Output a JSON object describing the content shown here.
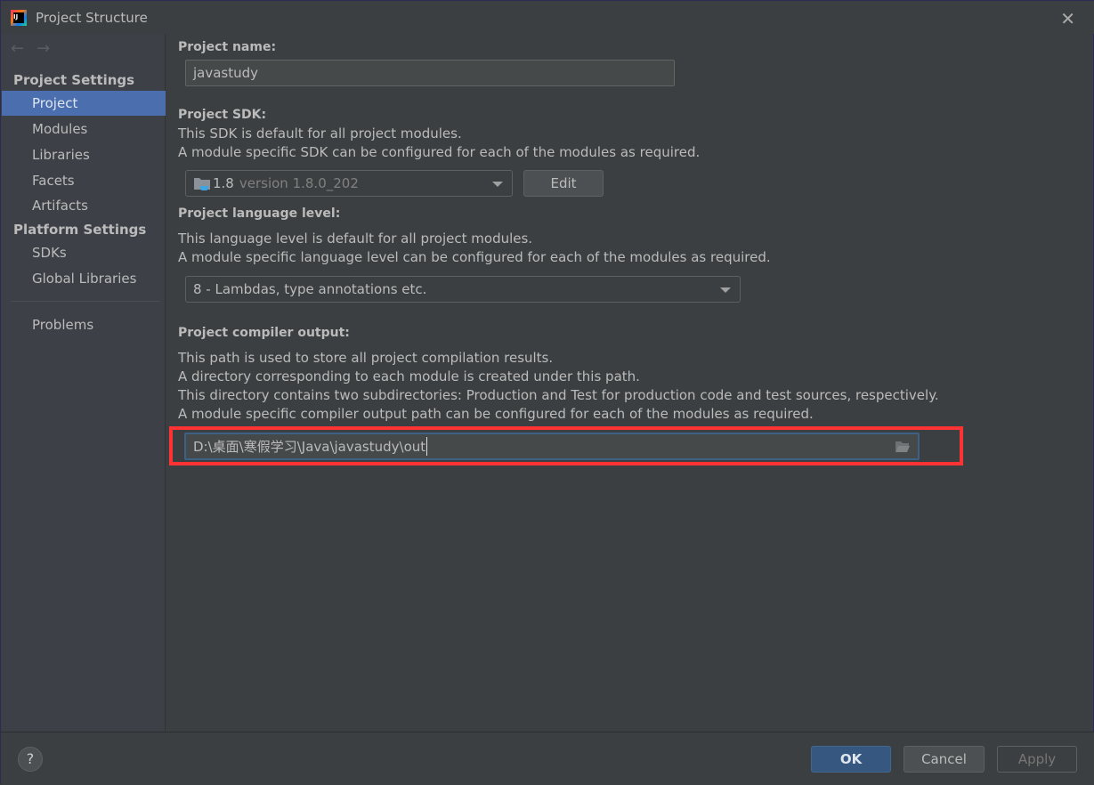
{
  "window": {
    "title": "Project Structure",
    "close": "✕"
  },
  "nav": {
    "back": "←",
    "forward": "→"
  },
  "sidebar": {
    "project_settings": "Project Settings",
    "project_items": [
      {
        "label": "Project",
        "selected": true
      },
      {
        "label": "Modules"
      },
      {
        "label": "Libraries"
      },
      {
        "label": "Facets"
      },
      {
        "label": "Artifacts"
      }
    ],
    "platform_settings": "Platform Settings",
    "platform_items": [
      {
        "label": "SDKs"
      },
      {
        "label": "Global Libraries"
      }
    ],
    "problems": "Problems"
  },
  "main": {
    "name_label": "Project name:",
    "name_value": "javastudy",
    "sdk_label": "Project SDK:",
    "sdk_desc1": "This SDK is default for all project modules.",
    "sdk_desc2": "A module specific SDK can be configured for each of the modules as required.",
    "sdk_value": "1.8",
    "sdk_version": "version 1.8.0_202",
    "sdk_edit": "Edit",
    "lang_label": "Project language level:",
    "lang_desc1": "This language level is default for all project modules.",
    "lang_desc2": "A module specific language level can be configured for each of the modules as required.",
    "lang_value": "8 - Lambdas, type annotations etc.",
    "out_label": "Project compiler output:",
    "out_desc1": "This path is used to store all project compilation results.",
    "out_desc2": "A directory corresponding to each module is created under this path.",
    "out_desc3": "This directory contains two subdirectories: Production and Test for production code and test sources, respectively.",
    "out_desc4": "A module specific compiler output path can be configured for each of the modules as required.",
    "out_value": "D:\\桌面\\寒假学习\\Java\\javastudy\\out"
  },
  "footer": {
    "help": "?",
    "ok": "OK",
    "cancel": "Cancel",
    "apply": "Apply"
  },
  "colors": {
    "selection": "#4b6eaf",
    "highlight": "#ff3333",
    "ok_button": "#365880"
  }
}
